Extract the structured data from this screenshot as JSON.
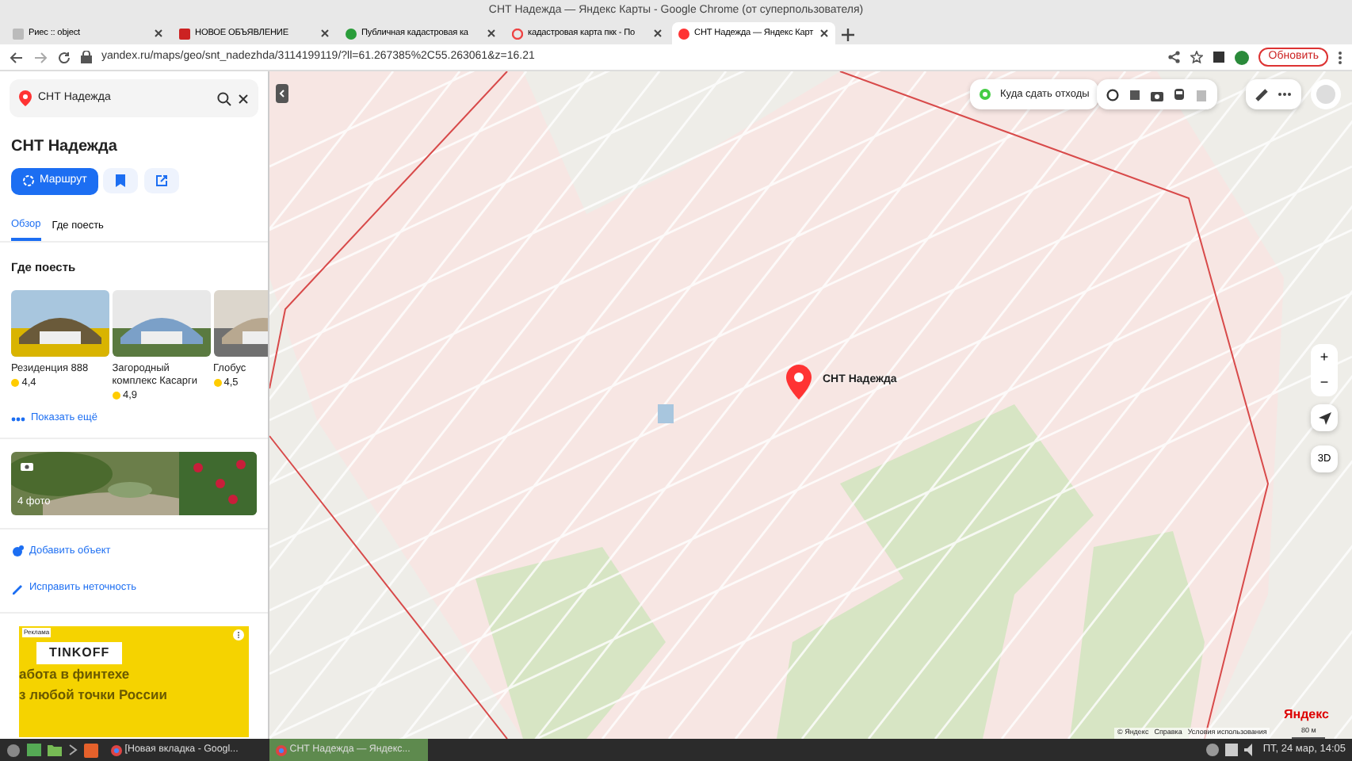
{
  "window": {
    "title": "СНТ Надежда — Яндекс Карты - Google Chrome (от суперпользователя)"
  },
  "tabs": [
    {
      "label": "Риес :: object",
      "selected": false
    },
    {
      "label": "НОВОЕ ОБЪЯВЛЕНИЕ",
      "selected": false
    },
    {
      "label": "Публичная кадастровая ка",
      "selected": false
    },
    {
      "label": "кадастровая карта пкк - По",
      "selected": false
    },
    {
      "label": "СНТ Надежда — Яндекс Карт",
      "selected": true
    }
  ],
  "address_bar": {
    "url": "yandex.ru/maps/geo/snt_nadezhda/3114199119/?ll=61.267385%2C55.263061&z=16.21",
    "update_button": "Обновить"
  },
  "search": {
    "value": "СНТ Надежда"
  },
  "place": {
    "title": "СНТ Надежда",
    "route_button": "Маршрут",
    "tabs": [
      {
        "label": "Обзор",
        "selected": true
      },
      {
        "label": "Где поесть",
        "selected": false
      }
    ]
  },
  "where_to_eat": {
    "heading": "Где поесть",
    "places": [
      {
        "name": "Резиденция 888",
        "rating": "4,4"
      },
      {
        "name": "Загородный комплекс Касарги",
        "rating": "4,9"
      },
      {
        "name": "Глобус",
        "rating": "4,5"
      }
    ],
    "more": "Показать ещё"
  },
  "photos": {
    "count": "4 фото"
  },
  "actions": [
    "Добавить объект",
    "Исправить неточность"
  ],
  "ad": {
    "label": "Реклама",
    "brand": "TINKOFF",
    "lines": [
      "абота в финтехе",
      "з любой точки России"
    ]
  },
  "map": {
    "waste_button": "Куда сдать отходы",
    "marker_label": "СНТ Надежда",
    "zoom_in": "+",
    "zoom_out": "−",
    "three_d": "3D",
    "footer_links": [
      "© Яндекс",
      "Справка",
      "Условия использования"
    ],
    "scale": "80 м",
    "logo": "Яндекс"
  },
  "taskbar": {
    "windows": [
      {
        "label": "[Новая вкладка - Googl...",
        "selected": false
      },
      {
        "label": "СНТ Надежда — Яндекс...",
        "selected": true
      }
    ],
    "clock": "ПТ, 24 мар, 14:05"
  }
}
